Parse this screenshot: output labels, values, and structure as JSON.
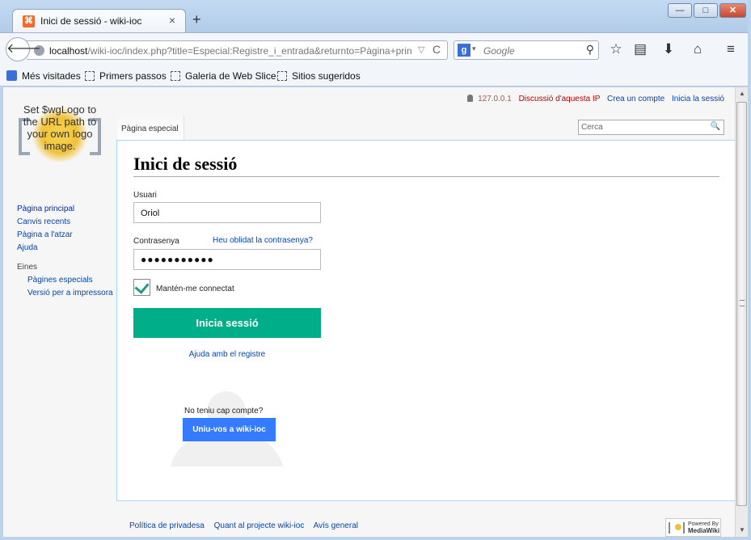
{
  "browser": {
    "tab_title": "Inici de sessió - wiki-ioc",
    "tab_close": "×",
    "new_tab": "+",
    "window_min": "—",
    "window_max": "□",
    "window_close": "✕",
    "back_glyph": "🡐",
    "url_host": "localhost",
    "url_rest": "/wiki-ioc/index.php?title=Especial:Registre_i_entrada&returnto=Pàgina+prin",
    "url_dropdown": "▽",
    "reload": "C",
    "search_engine_glyph": "g",
    "search_engine_drop": "▾",
    "search_placeholder": "Google",
    "search_go": "⚲",
    "icons": {
      "bookmark_star": "☆",
      "reading_list": "▤",
      "download": "⬇",
      "home": "⌂",
      "menu": "≡"
    },
    "bookmarks": [
      "Més visitades",
      "Primers passos",
      "Galeria de Web Slice",
      "Sitios sugeridos"
    ]
  },
  "wiki": {
    "logo_text": "Set $wgLogo to the URL path to your own logo image.",
    "personal": {
      "ip": "127.0.0.1",
      "talk": "Discussió d'aquesta IP",
      "create": "Crea un compte",
      "login": "Inicia la sessió"
    },
    "tab": "Pàgina especial",
    "search_placeholder": "Cerca",
    "search_icon": "🔍",
    "sidebar": {
      "nav": [
        "Pàgina principal",
        "Canvis recents",
        "Pàgina a l'atzar",
        "Ajuda"
      ],
      "tools_heading": "Eines",
      "tools": [
        "Pàgines especials",
        "Versió per a impressora"
      ]
    },
    "form": {
      "title": "Inici de sessió",
      "username_label": "Usuari",
      "username_value": "Oriol",
      "password_label": "Contrasenya",
      "forgot_link": "Heu oblidat la contrasenya?",
      "password_value": "●●●●●●●●●●●",
      "remember_label": "Mantén-me connectat",
      "remember_checked": true,
      "submit": "Inicia sessió",
      "help_link": "Ajuda amb el registre",
      "no_account": "No teniu cap compte?",
      "join_button": "Uniu-vos a wiki-ioc"
    },
    "footer": [
      "Política de privadesa",
      "Quant al projecte wiki-ioc",
      "Avís general"
    ],
    "powered_by": {
      "line1": "Powered By",
      "line2": "MediaWiki"
    },
    "accent_colors": {
      "submit": "#00af89",
      "join": "#347bff",
      "links": "#0645ad"
    }
  }
}
